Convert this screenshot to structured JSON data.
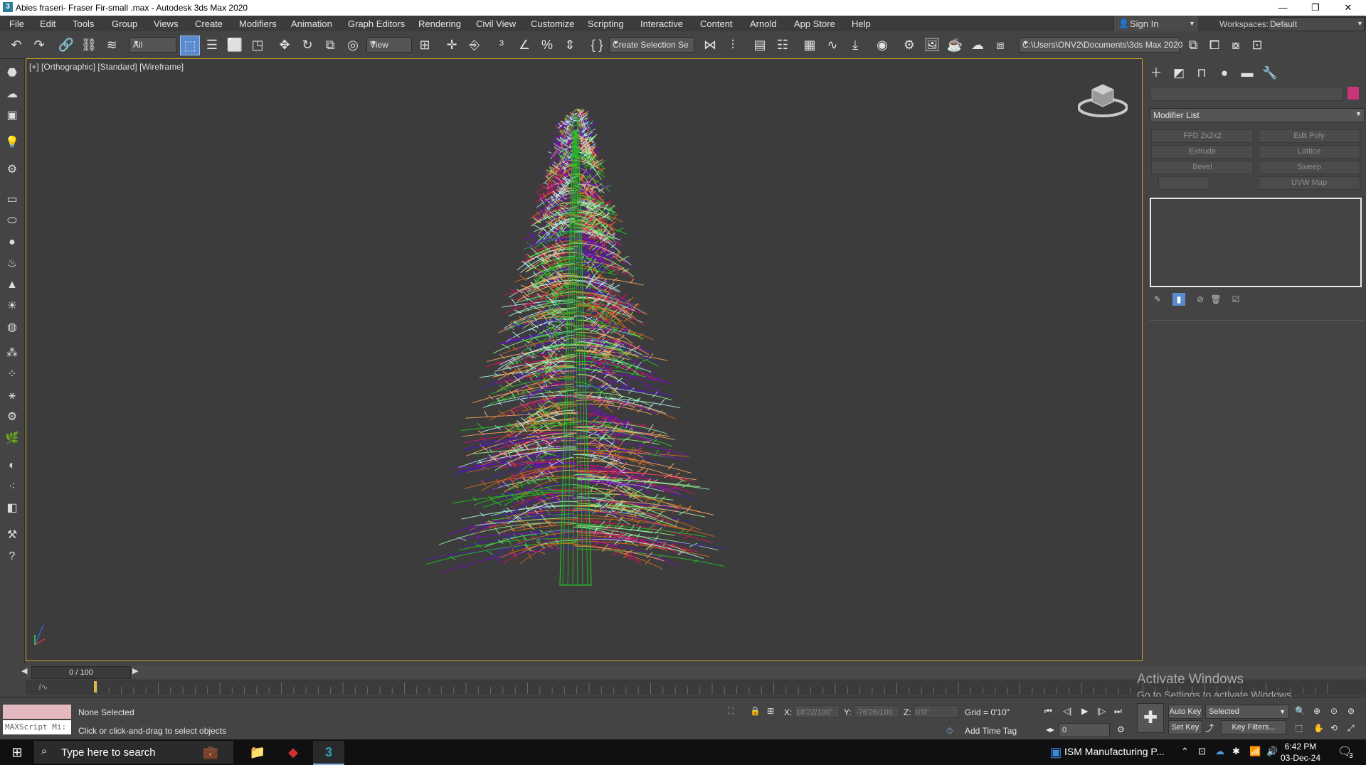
{
  "window": {
    "title": "Abies fraseri- Fraser Fir-small .max - Autodesk 3ds Max 2020",
    "minimize_glyph": "—",
    "maximize_glyph": "❐",
    "close_glyph": "✕"
  },
  "menubar": {
    "items": [
      "File",
      "Edit",
      "Tools",
      "Group",
      "Views",
      "Create",
      "Modifiers",
      "Animation",
      "Graph Editors",
      "Rendering",
      "Civil View",
      "Customize",
      "Scripting",
      "Interactive",
      "Content",
      "Arnold",
      "App Store",
      "Help"
    ],
    "sign_in": "Sign In",
    "workspaces_label": "Workspaces:",
    "workspaces_value": "Default"
  },
  "toolbar": {
    "selection_filter": "All",
    "reference_coord": "View",
    "selection_set_placeholder": "Create Selection Se",
    "project_path": "C:\\Users\\ONV2\\Documents\\3ds Max 2020"
  },
  "viewport": {
    "label": "[+] [Orthographic] [Standard] [Wireframe]",
    "border_color": "#c9a227",
    "tree_colors": [
      "#4b1bb5",
      "#90ee90",
      "#f4a460",
      "#b3f0f0",
      "#d4145a",
      "#7a0dc2",
      "#22c322",
      "#d2691e"
    ]
  },
  "command_panel": {
    "modifier_list_label": "Modifier List",
    "color_swatch": "#c8357a",
    "modifier_buttons": [
      "FFD 2x2x2",
      "Edit Poly",
      "Extrude",
      "Lattice",
      "Bevel",
      "Sweep",
      "",
      "UVW Map"
    ]
  },
  "time_slider": {
    "frame": "0 / 100"
  },
  "status": {
    "maxscript_label": "MAXScript Mi:",
    "selection": "None Selected",
    "prompt": "Click or click-and-drag to select objects",
    "x_label": "X:",
    "x_value": "18'22/100'",
    "y_label": "Y:",
    "y_value": "-76'26/100",
    "z_label": "Z:",
    "z_value": "0'0\"",
    "grid": "Grid = 0'10\"",
    "add_time_tag": "Add Time Tag",
    "auto_key": "Auto Key",
    "set_key": "Set Key",
    "key_mode": "Selected",
    "key_filters": "Key Filters...",
    "frame_field": "0"
  },
  "watermark": {
    "line1": "Activate Windows",
    "line2": "Go to Settings to activate Windows."
  },
  "taskbar": {
    "search_placeholder": "Type here to search",
    "app_label": "ISM Manufacturing P...",
    "time": "6:42 PM",
    "date": "03-Dec-24",
    "notification_count": "3"
  }
}
